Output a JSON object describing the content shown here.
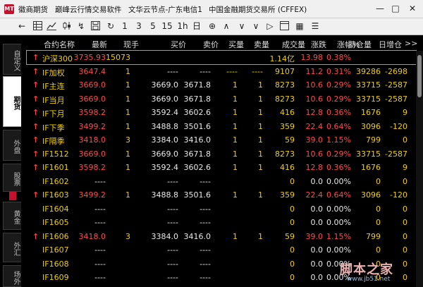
{
  "titlebar": {
    "logo_text": "MT",
    "app_name": "徽商期货",
    "software_name": "巅峰云行情交易软件",
    "server": "文华云节点-广东电信1",
    "exchange": "中国金融期货交易所 (CFFEX)"
  },
  "toolbar": {
    "period_1": "1",
    "period_3": "3",
    "period_5": "5",
    "period_15": "15",
    "period_1h": "1h",
    "period_d": "日"
  },
  "sidebar": {
    "tabs": [
      "自定义",
      "期货",
      "外盘",
      "股票",
      "黄金",
      "外汇",
      "场外"
    ],
    "active": "期货"
  },
  "table": {
    "headers": [
      "合约名称",
      "最新",
      "现手",
      "买价",
      "卖价",
      "买量",
      "卖量",
      "成交量",
      "涨跌",
      "涨幅%",
      "持仓量",
      "日增仓"
    ],
    "more": ">>",
    "rows": [
      {
        "arrow": "↑",
        "name": "沪深300",
        "last": "3735.93",
        "hand": "15073",
        "bid": "",
        "ask": "",
        "bidv": "",
        "askv": "",
        "vol": "1.14亿",
        "chg": "13.98",
        "pct": "0.38%",
        "oi": "",
        "inc": ""
      },
      {
        "arrow": "↑",
        "name": "IF加权",
        "last": "3647.4",
        "hand": "1",
        "bid": "----",
        "ask": "----",
        "bidv": "----",
        "askv": "----",
        "vol": "9107",
        "chg": "11.2",
        "pct": "0.31%",
        "oi": "39286",
        "inc": "-2698"
      },
      {
        "arrow": "↑",
        "name": "IF主连",
        "last": "3669.0",
        "hand": "1",
        "bid": "3669.0",
        "ask": "3671.8",
        "bidv": "1",
        "askv": "1",
        "vol": "8273",
        "chg": "10.6",
        "pct": "0.29%",
        "oi": "33715",
        "inc": "-2587"
      },
      {
        "arrow": "↑",
        "name": "IF当月",
        "last": "3669.0",
        "hand": "1",
        "bid": "3669.0",
        "ask": "3671.8",
        "bidv": "1",
        "askv": "1",
        "vol": "8273",
        "chg": "10.6",
        "pct": "0.29%",
        "oi": "33715",
        "inc": "-2587"
      },
      {
        "arrow": "↑",
        "name": "IF下月",
        "last": "3598.2",
        "hand": "1",
        "bid": "3592.4",
        "ask": "3602.6",
        "bidv": "1",
        "askv": "1",
        "vol": "416",
        "chg": "12.8",
        "pct": "0.36%",
        "oi": "1676",
        "inc": "9"
      },
      {
        "arrow": "↑",
        "name": "IF下季",
        "last": "3499.2",
        "hand": "1",
        "bid": "3488.8",
        "ask": "3501.6",
        "bidv": "1",
        "askv": "1",
        "vol": "359",
        "chg": "22.4",
        "pct": "0.64%",
        "oi": "3096",
        "inc": "-120"
      },
      {
        "arrow": "↑",
        "name": "IF隔季",
        "last": "3418.0",
        "hand": "3",
        "bid": "3384.0",
        "ask": "3416.0",
        "bidv": "1",
        "askv": "1",
        "vol": "59",
        "chg": "39.0",
        "pct": "1.15%",
        "oi": "799",
        "inc": "0"
      },
      {
        "arrow": "↑",
        "name": "IF1512",
        "last": "3669.0",
        "hand": "1",
        "bid": "3669.0",
        "ask": "3671.8",
        "bidv": "1",
        "askv": "1",
        "vol": "8273",
        "chg": "10.6",
        "pct": "0.29%",
        "oi": "33715",
        "inc": "-2587"
      },
      {
        "arrow": "↑",
        "name": "IF1601",
        "last": "3598.2",
        "hand": "1",
        "bid": "3592.4",
        "ask": "3602.6",
        "bidv": "1",
        "askv": "1",
        "vol": "416",
        "chg": "12.8",
        "pct": "0.36%",
        "oi": "1676",
        "inc": "9"
      },
      {
        "arrow": "",
        "name": "IF1602",
        "last": "----",
        "hand": "",
        "bid": "----",
        "ask": "----",
        "bidv": "",
        "askv": "",
        "vol": "0",
        "chg": "0.0",
        "pct": "0.00%",
        "oi": "0",
        "inc": "0"
      },
      {
        "arrow": "↑",
        "name": "IF1603",
        "last": "3499.2",
        "hand": "1",
        "bid": "3488.8",
        "ask": "3501.6",
        "bidv": "1",
        "askv": "1",
        "vol": "359",
        "chg": "22.4",
        "pct": "0.64%",
        "oi": "3096",
        "inc": "-120"
      },
      {
        "arrow": "",
        "name": "IF1604",
        "last": "----",
        "hand": "",
        "bid": "----",
        "ask": "----",
        "bidv": "",
        "askv": "",
        "vol": "0",
        "chg": "0.0",
        "pct": "0.00%",
        "oi": "0",
        "inc": "0"
      },
      {
        "arrow": "",
        "name": "IF1605",
        "last": "----",
        "hand": "",
        "bid": "----",
        "ask": "----",
        "bidv": "",
        "askv": "",
        "vol": "0",
        "chg": "0.0",
        "pct": "0.00%",
        "oi": "0",
        "inc": "0"
      },
      {
        "arrow": "↑",
        "name": "IF1606",
        "last": "3418.0",
        "hand": "3",
        "bid": "3384.0",
        "ask": "3416.0",
        "bidv": "1",
        "askv": "1",
        "vol": "59",
        "chg": "39.0",
        "pct": "1.15%",
        "oi": "799",
        "inc": "0"
      },
      {
        "arrow": "",
        "name": "IF1607",
        "last": "----",
        "hand": "",
        "bid": "----",
        "ask": "----",
        "bidv": "",
        "askv": "",
        "vol": "0",
        "chg": "0.0",
        "pct": "0.00%",
        "oi": "0",
        "inc": "0"
      },
      {
        "arrow": "",
        "name": "IF1608",
        "last": "----",
        "hand": "",
        "bid": "----",
        "ask": "----",
        "bidv": "",
        "askv": "",
        "vol": "0",
        "chg": "0.0",
        "pct": "0.00%",
        "oi": "0",
        "inc": "0"
      },
      {
        "arrow": "",
        "name": "IF1609",
        "last": "----",
        "hand": "",
        "bid": "----",
        "ask": "----",
        "bidv": "",
        "askv": "",
        "vol": "0",
        "chg": "0.0",
        "pct": "0.00%",
        "oi": "0",
        "inc": "0"
      }
    ]
  },
  "watermark": {
    "text": "脚本之家",
    "url": "www.jb51.net"
  },
  "colors": {
    "up": "#ff4a4a",
    "name": "#f0d000",
    "neutral": "#e8e8e8",
    "down": "#28d628",
    "background": "#000000"
  }
}
